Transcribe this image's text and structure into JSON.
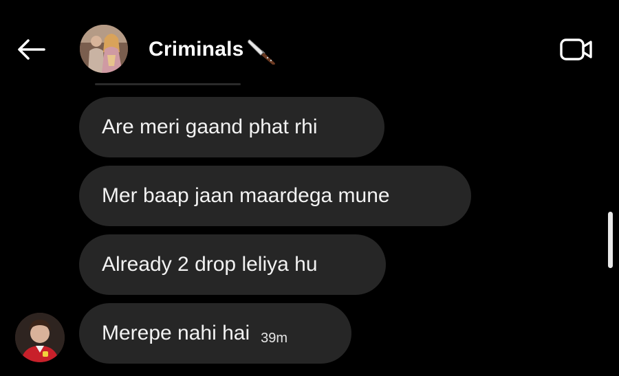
{
  "header": {
    "title": "Criminals",
    "back_icon": "arrow-left-icon",
    "title_emoji": "knife-icon",
    "video_icon": "video-call-icon"
  },
  "messages": [
    {
      "text": "Are meri gaand phat rhi"
    },
    {
      "text": "Mer baap jaan maardega mune"
    },
    {
      "text": "Already 2 drop leliya hu"
    },
    {
      "text": "Merepe nahi hai",
      "time": "39m"
    }
  ],
  "colors": {
    "background": "#000000",
    "bubble": "#262626",
    "text": "#ffffff",
    "scrollbar": "#e8e8e8"
  }
}
